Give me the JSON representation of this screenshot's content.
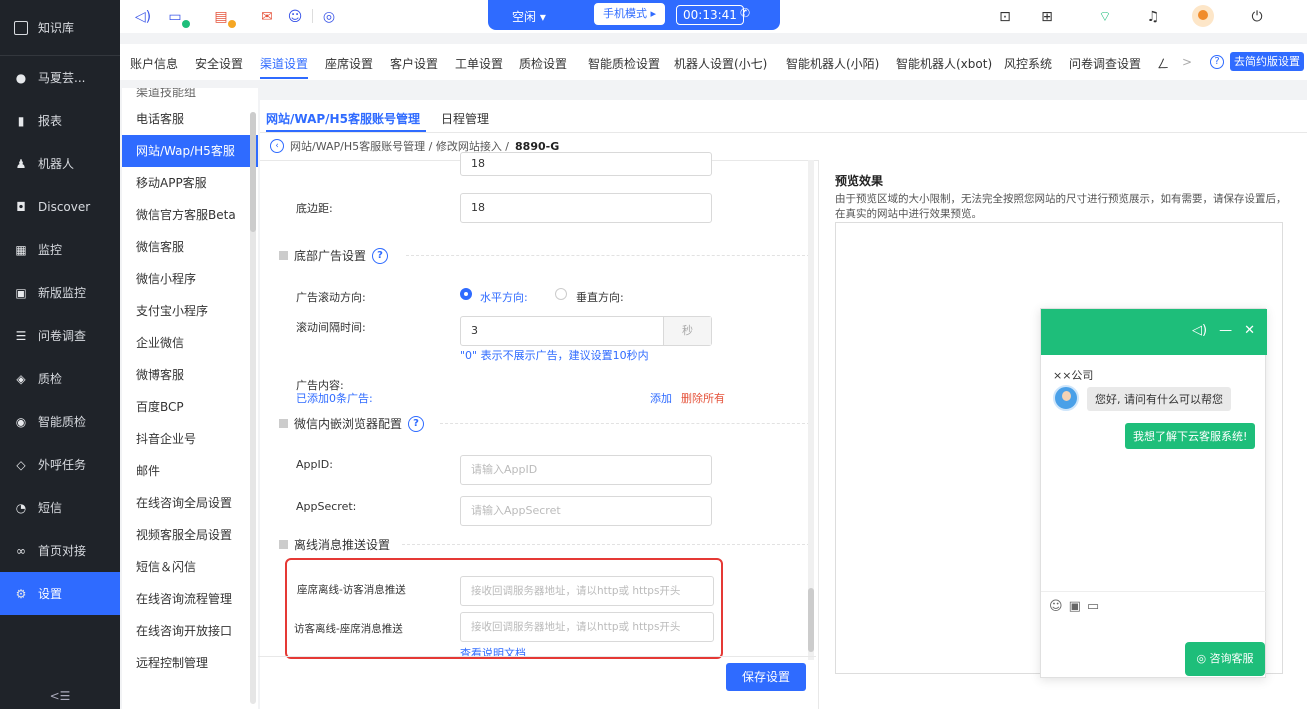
{
  "sidebar": {
    "brand": "知识库",
    "items": [
      {
        "label": "马夏芸...",
        "icon": "user-dot-icon"
      },
      {
        "label": "报表",
        "icon": "bar-chart-icon"
      },
      {
        "label": "机器人",
        "icon": "robot-icon"
      },
      {
        "label": "Discover",
        "icon": "discover-icon"
      },
      {
        "label": "监控",
        "icon": "monitor-icon"
      },
      {
        "label": "新版监控",
        "icon": "screen-icon"
      },
      {
        "label": "问卷调查",
        "icon": "survey-icon"
      },
      {
        "label": "质检",
        "icon": "shield-icon"
      },
      {
        "label": "智能质检",
        "icon": "smart-check-icon"
      },
      {
        "label": "外呼任务",
        "icon": "layers-icon"
      },
      {
        "label": "短信",
        "icon": "sms-icon"
      },
      {
        "label": "首页对接",
        "icon": "link-icon"
      },
      {
        "label": "设置",
        "icon": "gear-icon",
        "active": true
      }
    ],
    "collapse_glyph": "<☰"
  },
  "header": {
    "status": "空闲 ▾",
    "mode": "手机模式 ▸",
    "timer": "00:13:41"
  },
  "tabs": {
    "items": [
      "账户信息",
      "安全设置",
      "渠道设置",
      "座席设置",
      "客户设置",
      "工单设置",
      "质检设置",
      "智能质检设置",
      "机器人设置(小七)",
      "智能机器人(小陌)",
      "智能机器人(xbot)",
      "风控系统",
      "问卷调查设置",
      "ㄥ"
    ],
    "active": "渠道设置",
    "more": ">",
    "help": "?",
    "new_version": "去简约版设置"
  },
  "subnav": {
    "items": [
      "渠道技能组",
      "电话客服",
      "网站/Wap/H5客服",
      "移动APP客服",
      "微信官方客服Beta",
      "微信客服",
      "微信小程序",
      "支付宝小程序",
      "企业微信",
      "微博客服",
      "百度BCP",
      "抖音企业号",
      "邮件",
      "在线咨询全局设置",
      "视频客服全局设置",
      "短信＆闪信",
      "在线咨询流程管理",
      "在线咨询开放接口",
      "远程控制管理"
    ],
    "active": "网站/Wap/H5客服"
  },
  "main": {
    "tabs": [
      "网站/WAP/H5客服账号管理",
      "日程管理"
    ],
    "breadcrumb": {
      "path": "网站/WAP/H5客服账号管理 / 修改网站接入 /",
      "current": "8890-G"
    },
    "top_margin_value": "18",
    "bottom_margin": {
      "label": "底边距:",
      "value": "18"
    },
    "ad_section": {
      "title": "底部广告设置",
      "direction_label": "广告滚动方向:",
      "horizontal": "水平方向:",
      "vertical": "垂直方向:",
      "interval_label": "滚动间隔时间:",
      "interval_value": "3",
      "interval_unit": "秒",
      "interval_hint": "\"0\" 表示不展示广告，建议设置10秒内",
      "content_label": "广告内容:",
      "content_count": "已添加0条广告:",
      "add": "添加",
      "delete_all": "删除所有"
    },
    "wechat_section": {
      "title": "微信内嵌浏览器配置",
      "appid_label": "AppID:",
      "appid_placeholder": "请输入AppID",
      "secret_label": "AppSecret:",
      "secret_placeholder": "请输入AppSecret"
    },
    "offline_section": {
      "title": "离线消息推送设置",
      "seat_label": "座席离线-访客消息推送",
      "visitor_label": "访客离线-座席消息推送",
      "url_placeholder": "接收回调服务器地址，请以http或 https开头",
      "doc_link": "查看说明文档"
    },
    "save": "保存设置"
  },
  "preview": {
    "title": "预览效果",
    "desc": "由于预览区域的大小限制，无法完全按照您网站的尺寸进行预览展示，如有需要，请保存设置后，在真实的网站中进行效果预览。",
    "chat": {
      "company": "××公司",
      "greeting": "您好, 请问有什么可以帮您",
      "user_msg": "我想了解下云客服系统!",
      "consult": "咨询客服"
    }
  },
  "colors": {
    "primary": "#2f6bff",
    "chat_green": "#1ebe7a",
    "sidebar_bg": "#1f2329",
    "alert_red": "#e53935"
  }
}
